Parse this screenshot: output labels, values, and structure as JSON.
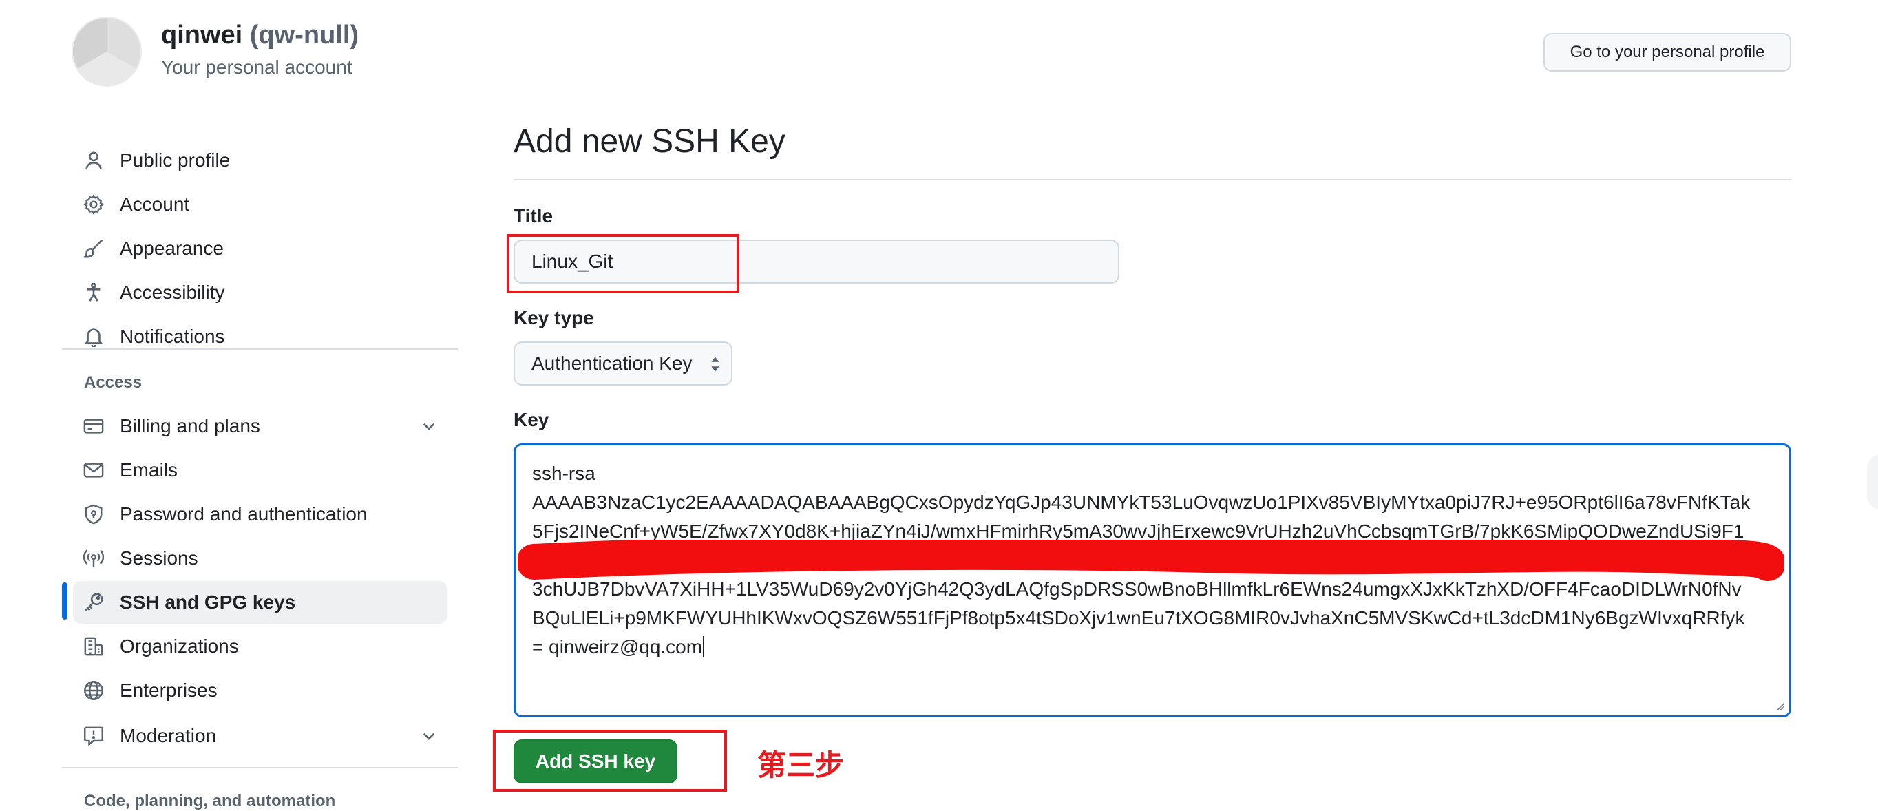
{
  "header": {
    "username": "qinwei",
    "handle": "(qw-null)",
    "subtitle": "Your personal account",
    "profile_button": "Go to your personal profile"
  },
  "sidebar": {
    "items": [
      {
        "label": "Public profile",
        "icon": "person-icon"
      },
      {
        "label": "Account",
        "icon": "gear-icon"
      },
      {
        "label": "Appearance",
        "icon": "paintbrush-icon"
      },
      {
        "label": "Accessibility",
        "icon": "accessibility-icon"
      },
      {
        "label": "Notifications",
        "icon": "bell-icon"
      }
    ],
    "access_heading": "Access",
    "access_items": [
      {
        "label": "Billing and plans",
        "icon": "credit-card-icon",
        "expandable": true
      },
      {
        "label": "Emails",
        "icon": "mail-icon"
      },
      {
        "label": "Password and authentication",
        "icon": "shield-lock-icon"
      },
      {
        "label": "Sessions",
        "icon": "broadcast-icon"
      },
      {
        "label": "SSH and GPG keys",
        "icon": "key-icon",
        "active": true
      },
      {
        "label": "Organizations",
        "icon": "organization-icon"
      },
      {
        "label": "Enterprises",
        "icon": "globe-icon"
      },
      {
        "label": "Moderation",
        "icon": "report-icon",
        "expandable": true
      }
    ],
    "code_heading": "Code, planning, and automation"
  },
  "main": {
    "title": "Add new SSH Key",
    "title_label": "Title",
    "title_value": "Linux_Git",
    "key_type_label": "Key type",
    "key_type_value": "Authentication Key",
    "key_label": "Key",
    "key_lines": [
      "ssh-rsa",
      "AAAAB3NzaC1yc2EAAAADAQABAAABgQCxsOpydzYqGJp43UNMYkT53LuOvqwzUo1PIXv85VBIyMYtxa0piJ7RJ+e95ORpt6lI6a78vFNfKTak",
      "5Fjs2INeCnf+yW5E/Zfwx7XY0d8K+hjiaZYn4iJ/wmxHFmirhRy5mA30wvJjhErxewc9VrUHzh2uVhCcbsqmTGrB/7pkK6SMipQODweZndUSi9F1",
      "",
      "3chUJB7DbvVA7XiHH+1LV35WuD69y2v0YjGh42Q3ydLAQfgSpDRSS0wBnoBHllmfkLr6EWns24umgxXJxKkTzhXD/OFF4FcaoDIDLWrN0fNv",
      "BQuLlELi+p9MKFWYUHhIKWxvOQSZ6W551fFjPf8otp5x4tSDoXjv1wnEu7tXOG8MIR0vJvhaXnC5MVSKwCd+tL3dcDM1Ny6BgzWIvxqRRfyk",
      "= qinweirz@qq.com"
    ],
    "submit_label": "Add SSH key"
  },
  "annotation": {
    "step_text": "第三步",
    "color": "#e8191f"
  },
  "colors": {
    "primary_button": "#1f883d",
    "focus_blue": "#0969da",
    "active_indicator": "#0969da"
  }
}
